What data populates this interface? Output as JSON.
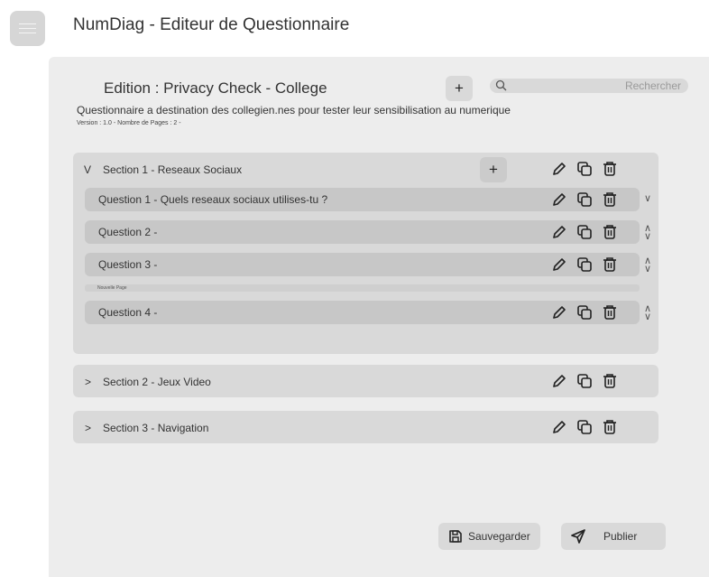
{
  "app": {
    "title": "NumDiag - Editeur de Questionnaire"
  },
  "header": {
    "edition_title": "Edition : Privacy Check - College",
    "add_label": "+",
    "search": {
      "placeholder": "Rechercher",
      "value": ""
    }
  },
  "questionnaire": {
    "description": "Questionnaire a destination des collegien.nes pour tester leur sensibilisation au numerique",
    "meta": "Version : 1.0 - Nombre de Pages : 2 -"
  },
  "sections": [
    {
      "toggle": "V",
      "title": "Section 1 - Reseaux Sociaux",
      "add_label": "+",
      "questions": [
        {
          "label": "Question 1 - Quels reseaux sociaux utilises-tu ?"
        },
        {
          "label": "Question 2 -"
        },
        {
          "label": "Question 3 -"
        },
        {
          "label": "Question 4 -"
        }
      ],
      "page_break_label": "Nouvelle Page"
    },
    {
      "toggle": ">",
      "title": "Section 2 - Jeux Video"
    },
    {
      "toggle": ">",
      "title": "Section 3 - Navigation"
    }
  ],
  "footer": {
    "save_label": "Sauvegarder",
    "publish_label": "Publier"
  },
  "colors": {
    "panel": "#ededed",
    "section": "#d9d9d9",
    "question_row": "#c7c7c7",
    "button": "#d9d9d9"
  }
}
